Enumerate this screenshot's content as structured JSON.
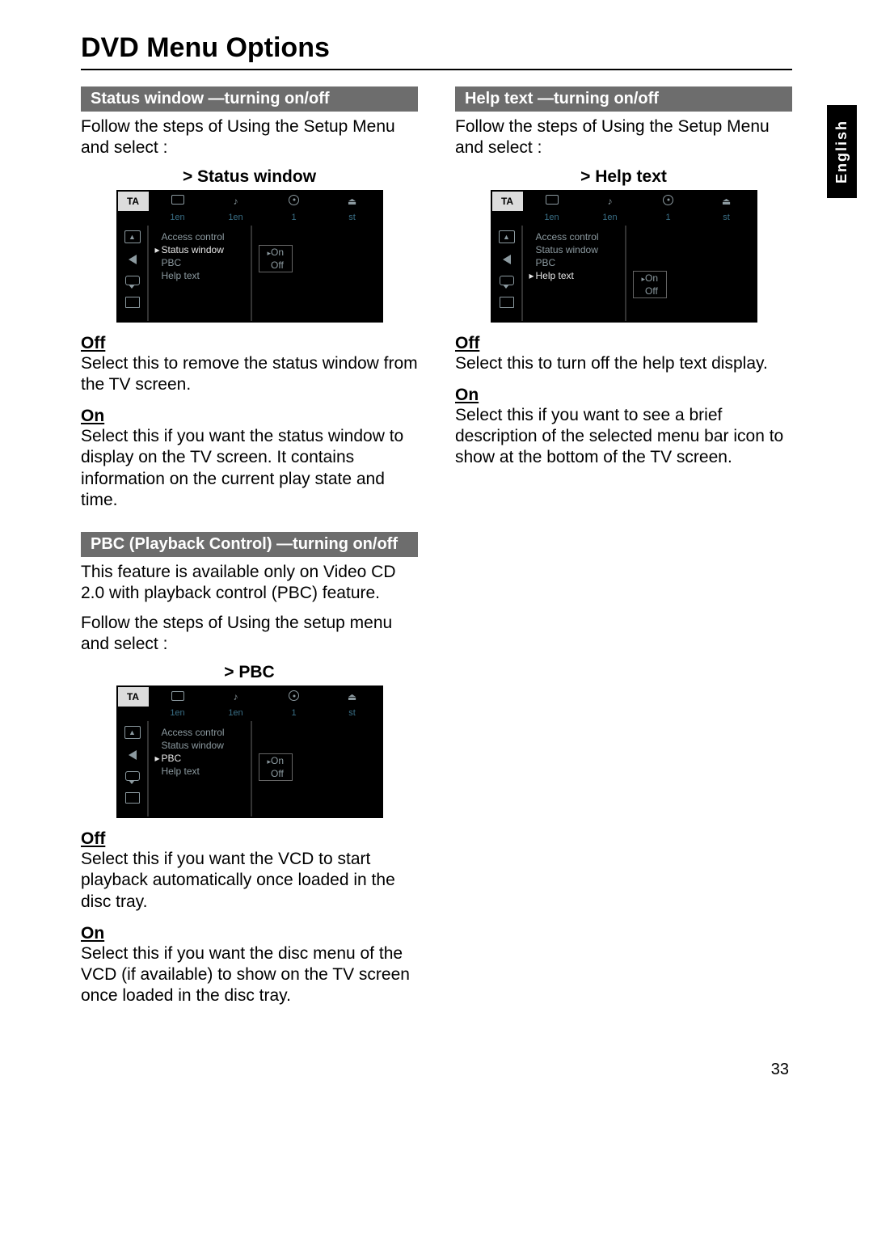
{
  "title": "DVD Menu Options",
  "langTab": "English",
  "pageNumber": "33",
  "osdCommon": {
    "val1": "1en",
    "val2": "1en",
    "val3": "1",
    "val4": "st",
    "item_access": "Access control",
    "item_status": "Status window",
    "item_pbc": "PBC",
    "item_help": "Help text",
    "opt_on": "On",
    "opt_off": "Off",
    "ta": "TA",
    "tri": "▲"
  },
  "left": {
    "status": {
      "band": "Status window —turning on/off",
      "intro": "Follow the steps of  Using the Setup Menu  and select :",
      "caption": ">  Status window",
      "offH": "Off",
      "offT": "Select this to remove the status window from the TV screen.",
      "onH": "On",
      "onT": "Select this if you want the status window to display on the TV screen.  It contains information on the current play state and time."
    },
    "pbc": {
      "band": "PBC (Playback Control) —turning on/off",
      "intro1": "This feature is available only on Video CD 2.0 with playback control (PBC) feature.",
      "intro2": "Follow the steps of  Using the setup menu  and select :",
      "caption": ">  PBC",
      "offH": "Off",
      "offT": "Select this if you want the VCD to start playback automatically once loaded in the disc tray.",
      "onH": "On",
      "onT": "Select this if you want the disc menu of the VCD (if available) to show on the TV screen once loaded in the disc tray."
    }
  },
  "right": {
    "help": {
      "band": "Help text —turning on/off",
      "intro": "Follow the steps of  Using the Setup Menu  and select :",
      "caption": ">  Help text",
      "offH": "Off",
      "offT": "Select this to turn off the help text display.",
      "onH": "On",
      "onT": "Select this if you want to see a brief description of the selected menu bar icon to show at the bottom of the TV screen."
    }
  }
}
